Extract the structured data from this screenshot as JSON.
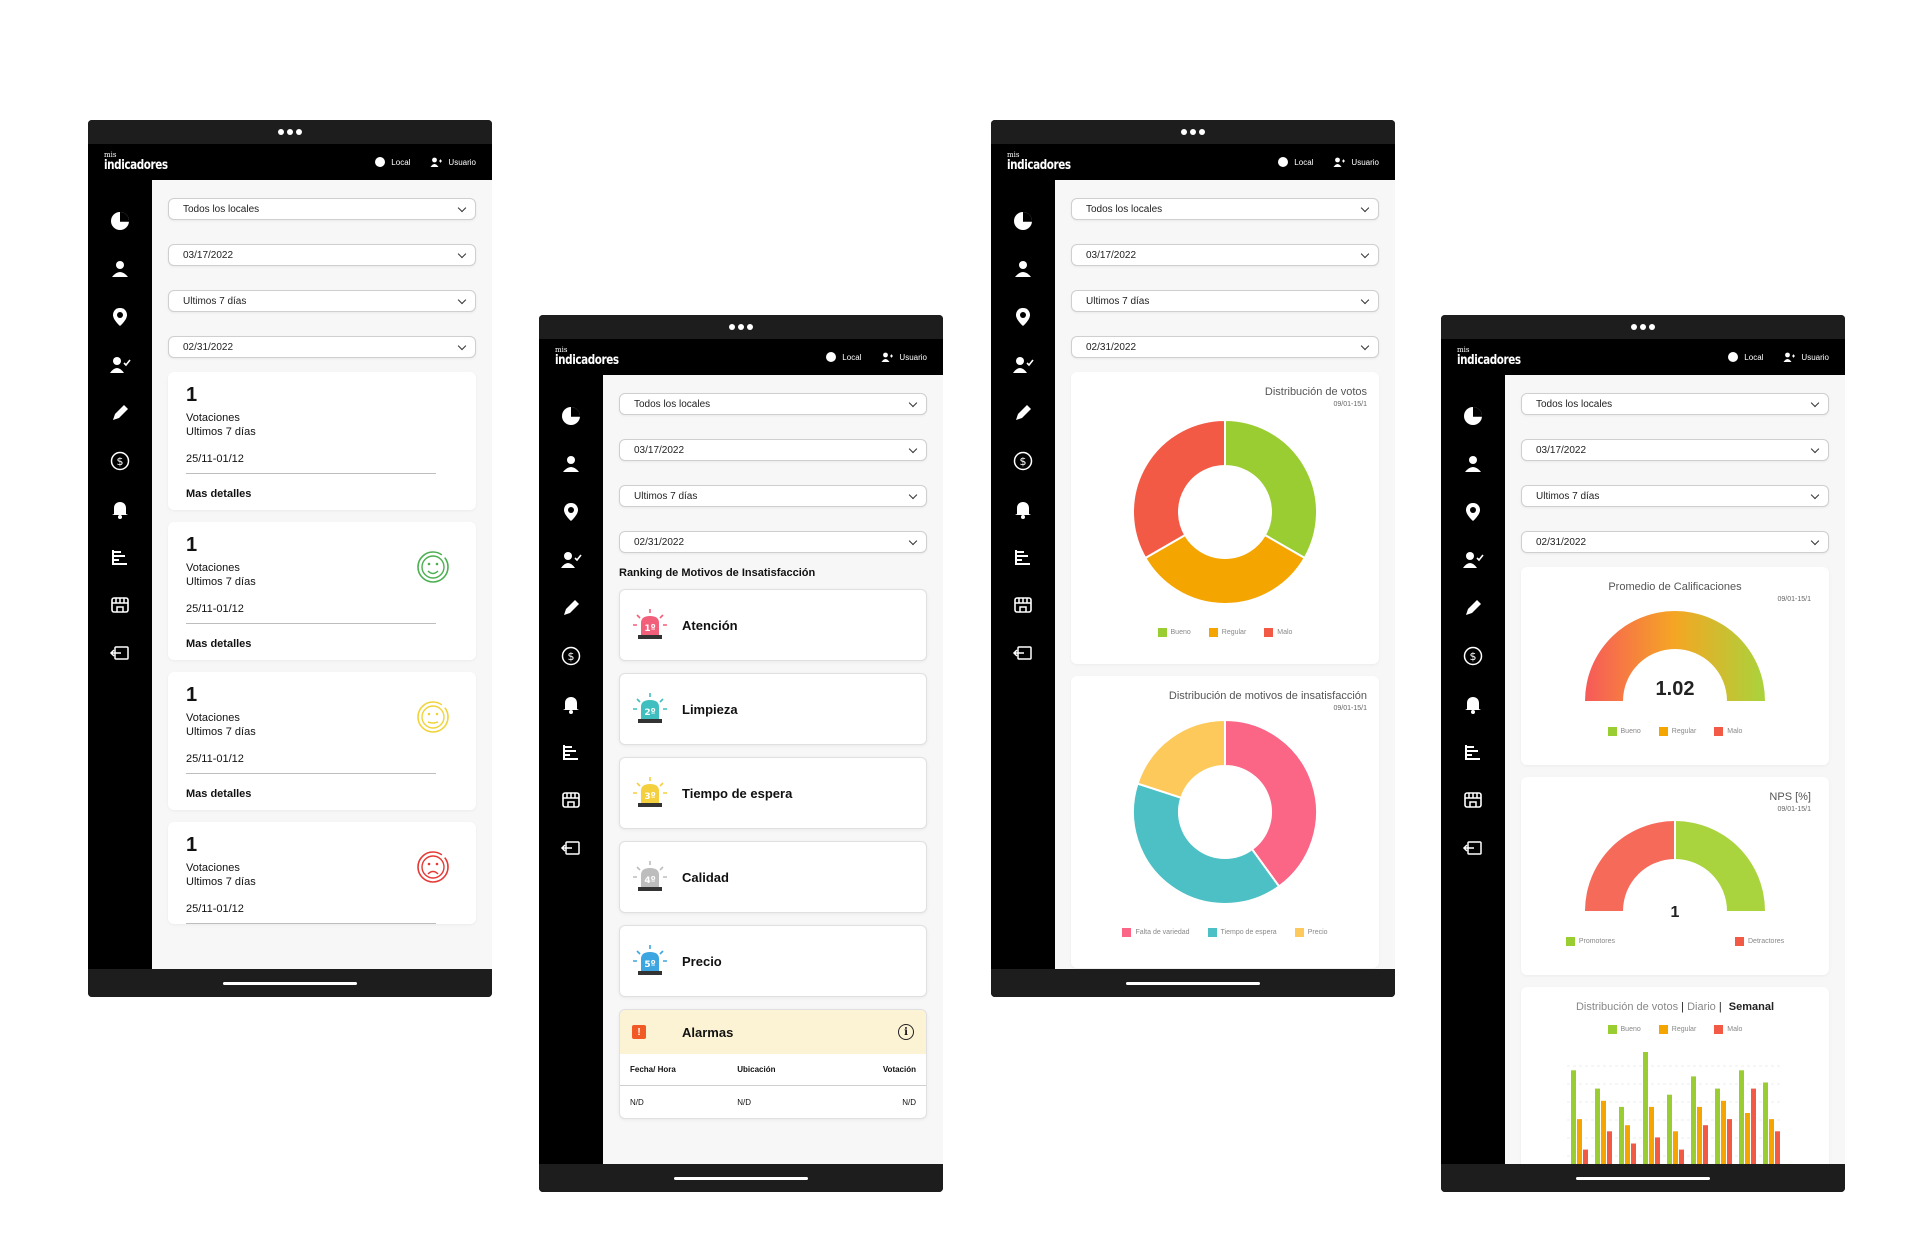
{
  "brand": {
    "small": "mis",
    "big": "indicadores"
  },
  "header": {
    "local_label": "Local",
    "user_label": "Usuario"
  },
  "filters": {
    "locales": "Todos los locales",
    "date_from": "03/17/2022",
    "range": "Ultimos 7 días",
    "date_to": "02/31/2022"
  },
  "vote_cards": [
    {
      "count": "1",
      "label1": "Votaciones",
      "label2": "Ultimos 7 días",
      "date": "25/11-01/12",
      "more": "Mas detalles",
      "face": "none"
    },
    {
      "count": "1",
      "label1": "Votaciones",
      "label2": "Ultimos 7 días",
      "date": "25/11-01/12",
      "more": "Mas detalles",
      "face": "happy"
    },
    {
      "count": "1",
      "label1": "Votaciones",
      "label2": "Ultimos 7 días",
      "date": "25/11-01/12",
      "more": "Mas detalles",
      "face": "neutral"
    },
    {
      "count": "1",
      "label1": "Votaciones",
      "label2": "Ultimos 7 días",
      "date": "25/11-01/12",
      "more": "",
      "face": "sad"
    }
  ],
  "ranking": {
    "title": "Ranking de Motivos de Insatisfacción",
    "items": [
      {
        "rank": "1º",
        "label": "Atención",
        "color": "#f25f7a"
      },
      {
        "rank": "2º",
        "label": "Limpieza",
        "color": "#3fbfbf"
      },
      {
        "rank": "3º",
        "label": "Tiempo de espera",
        "color": "#f4d03f"
      },
      {
        "rank": "4º",
        "label": "Calidad",
        "color": "#bdbdbd"
      },
      {
        "rank": "5º",
        "label": "Precio",
        "color": "#3da5e0"
      }
    ]
  },
  "alarms": {
    "title": "Alarmas",
    "badge": "!",
    "info": "i",
    "columns": [
      "Fecha/ Hora",
      "Ubicación",
      "Votación"
    ],
    "rows": [
      [
        "N/D",
        "N/D",
        "N/D"
      ]
    ]
  },
  "colors": {
    "bueno": "#9acd32",
    "regular": "#f5a500",
    "malo": "#f25a45"
  },
  "chart_data": [
    {
      "type": "pie",
      "title": "Distribución de votos",
      "subtitle": "09/01-15/1",
      "labels": [
        "Bueno",
        "Regular",
        "Malo"
      ],
      "values": [
        1,
        1,
        1
      ],
      "colors": [
        "#9acd32",
        "#f5a500",
        "#f25a45"
      ]
    },
    {
      "type": "pie",
      "title": "Distribución de motivos de insatisfacción",
      "subtitle": "09/01-15/1",
      "labels": [
        "Falta de variedad",
        "Tiempo de espera",
        "Precio"
      ],
      "values": [
        40,
        40,
        20
      ],
      "colors": [
        "#fb6586",
        "#4cc0c4",
        "#fdc95a"
      ]
    },
    {
      "type": "gauge",
      "title": "Promedio de Calificaciones",
      "subtitle": "09/01-15/1",
      "value": 1.02,
      "value_label": "1.02",
      "labels": [
        "Bueno",
        "Regular",
        "Malo"
      ],
      "colors": [
        "#9acd32",
        "#f5a500",
        "#f25a45"
      ]
    },
    {
      "type": "gauge",
      "title": "NPS [%]",
      "subtitle": "09/01-15/1",
      "value": 1,
      "value_label": "1",
      "labels": [
        "Promotores",
        "Detractores"
      ],
      "colors": [
        "#9acd32",
        "#f25a45"
      ]
    },
    {
      "type": "bar",
      "title_prefix": "Distribución de votos",
      "title_daily": "Diario",
      "title_weekly": "Semanal",
      "separator": "|",
      "series": [
        {
          "name": "Bueno",
          "values": [
            85,
            70,
            55,
            100,
            65,
            80,
            70,
            85,
            75
          ]
        },
        {
          "name": "Regular",
          "values": [
            45,
            60,
            40,
            55,
            35,
            55,
            60,
            50,
            45
          ]
        },
        {
          "name": "Malo",
          "values": [
            20,
            35,
            25,
            30,
            20,
            40,
            45,
            70,
            35
          ]
        }
      ],
      "colors": [
        "#9acd32",
        "#f5a500",
        "#f25a45"
      ]
    }
  ]
}
